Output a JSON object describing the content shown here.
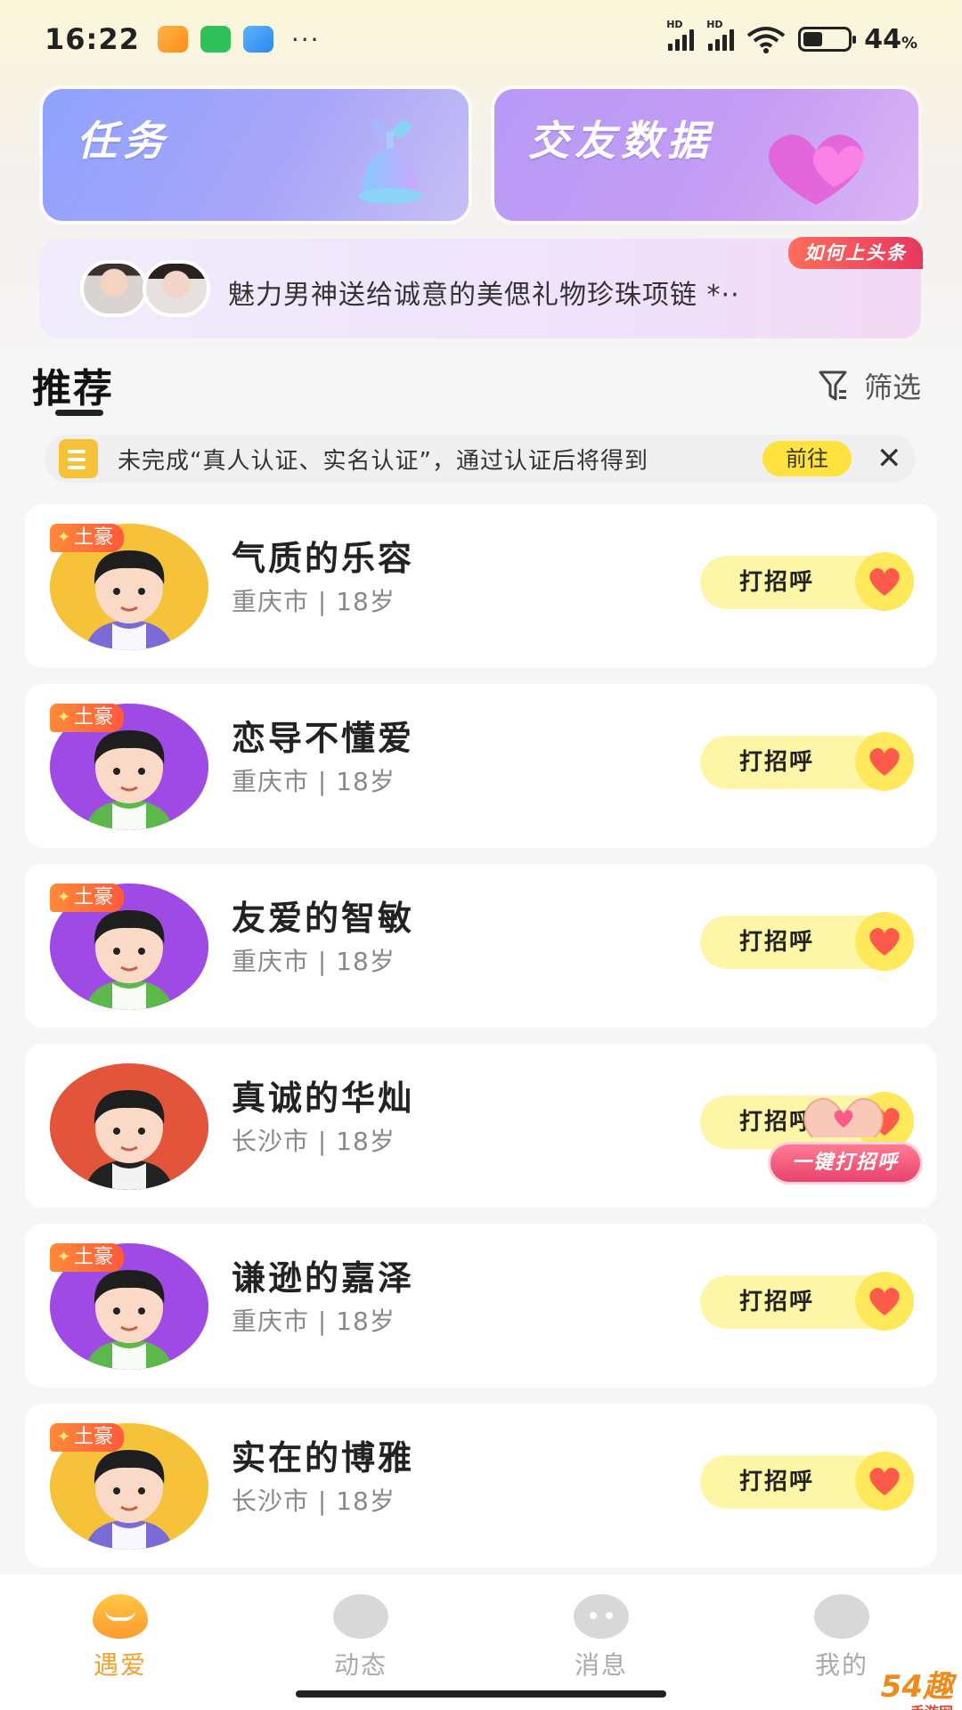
{
  "status_bar": {
    "time": "16:22",
    "notif_icons": [
      "gallery-notification-icon",
      "wechat-icon",
      "message-app-icon"
    ],
    "more": "···",
    "signal_1_label": "HD",
    "signal_2_label": "HD",
    "battery_percent": "44",
    "battery_unit": "%",
    "battery_level": 0.44
  },
  "banners": {
    "task_title": "任务",
    "data_title": "交友数据"
  },
  "headline": {
    "text": "魅力男神送给诚意的美偲礼物珍珠项链 *··",
    "tag": "如何上头条"
  },
  "section": {
    "title": "推荐",
    "filter_label": "筛选"
  },
  "notice": {
    "text": "未完成“真人认证、实名认证”，通过认证后将得到",
    "button": "前往",
    "close": "✕"
  },
  "badge_label": "土豪",
  "greet_label": "打招呼",
  "users": [
    {
      "name": "气质的乐容",
      "meta": "重庆市 | 18岁",
      "avatar_color": "#f5c23a",
      "tuhao": true
    },
    {
      "name": "恋导不懂爱",
      "meta": "重庆市 | 18岁",
      "avatar_color": "#a04ae6",
      "tuhao": true
    },
    {
      "name": "友爱的智敏",
      "meta": "重庆市 | 18岁",
      "avatar_color": "#a04ae6",
      "tuhao": true
    },
    {
      "name": "真诚的华灿",
      "meta": "长沙市 | 18岁",
      "avatar_color": "#e2553b",
      "tuhao": false
    },
    {
      "name": "谦逊的嘉泽",
      "meta": "重庆市 | 18岁",
      "avatar_color": "#a04ae6",
      "tuhao": true
    },
    {
      "name": "实在的博雅",
      "meta": "长沙市 | 18岁",
      "avatar_color": "#f5c23a",
      "tuhao": true
    }
  ],
  "one_key_greet": "一键打招呼",
  "bottom_nav": [
    {
      "label": "遇爱",
      "icon": "heart-icon",
      "active": true
    },
    {
      "label": "动态",
      "icon": "planet-icon",
      "active": false
    },
    {
      "label": "消息",
      "icon": "chat-bubble-icon",
      "active": false
    },
    {
      "label": "我的",
      "icon": "profile-icon",
      "active": false
    }
  ],
  "watermark": {
    "main": "54趣",
    "sub": "手游网"
  },
  "colors": {
    "accent_yellow": "#ffe23d",
    "nav_active": "#f3a02b",
    "badge_orange": "#ff6a3a",
    "headline_tag": "#e8375f"
  }
}
